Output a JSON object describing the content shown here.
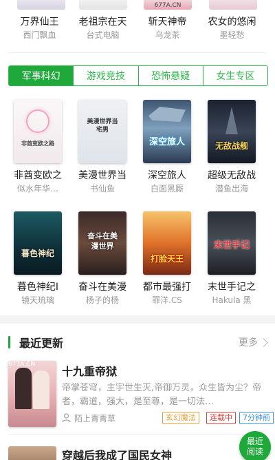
{
  "top_row": [
    {
      "title": "万界仙王",
      "author": "西门飘血",
      "cover_text": ""
    },
    {
      "title": "老祖宗在天",
      "author": "台式电脑",
      "cover_text": ""
    },
    {
      "title": "斩天神帝",
      "author": "乌龙茶",
      "cover_text": "677A.CN"
    },
    {
      "title": "农女的悠闲",
      "author": "墨轻愁",
      "cover_text": ""
    }
  ],
  "tabs": [
    "军事科幻",
    "游戏竞技",
    "恐怖悬疑",
    "女生专区"
  ],
  "active_tab": 0,
  "books": [
    {
      "title": "非酋变欧之",
      "author": "似水年华…",
      "cover_text": "非酋变欧之路"
    },
    {
      "title": "美漫世界当",
      "author": "书仙鱼",
      "cover_text": "美漫世界当宅男"
    },
    {
      "title": "深空旅人",
      "author": "白面黑厮",
      "cover_text": "深空旅人"
    },
    {
      "title": "超级无敌战",
      "author": "潜鱼出海",
      "cover_text": "无敌战舰"
    },
    {
      "title": "暮色神纪I",
      "author": "镜天琉璃",
      "cover_text": "暮色神纪"
    },
    {
      "title": "奋斗在美漫",
      "author": "杨子的杨",
      "cover_text": "奋斗在美漫世界"
    },
    {
      "title": "都市最强打",
      "author": "罪洋.CS",
      "cover_text": "打脸天王"
    },
    {
      "title": "末世手记之",
      "author": "Hakula 黑",
      "cover_text": "末世手记"
    }
  ],
  "recent_section": {
    "title": "最近更新",
    "more": "更多"
  },
  "recent": [
    {
      "title": "十九重帝狱",
      "description": "帝掌苍穹，主宇世生灭,帝御万灵，众生皆为尘？帝者，霸道，强大，是至尊，是一切法…",
      "author": "陌上青青草",
      "cover_text": "677A.CN",
      "tags": [
        {
          "label": "玄幻魔法",
          "color": "#e6a23c"
        },
        {
          "label": "连载中",
          "color": "#e0433a"
        },
        {
          "label": "7分钟前",
          "color": "#3a8ee6"
        }
      ]
    },
    {
      "title": "穿越后我成了国民女神"
    }
  ],
  "fab": {
    "line1": "最近",
    "line2": "阅读"
  },
  "colors": {
    "accent": "#1fa93a"
  }
}
